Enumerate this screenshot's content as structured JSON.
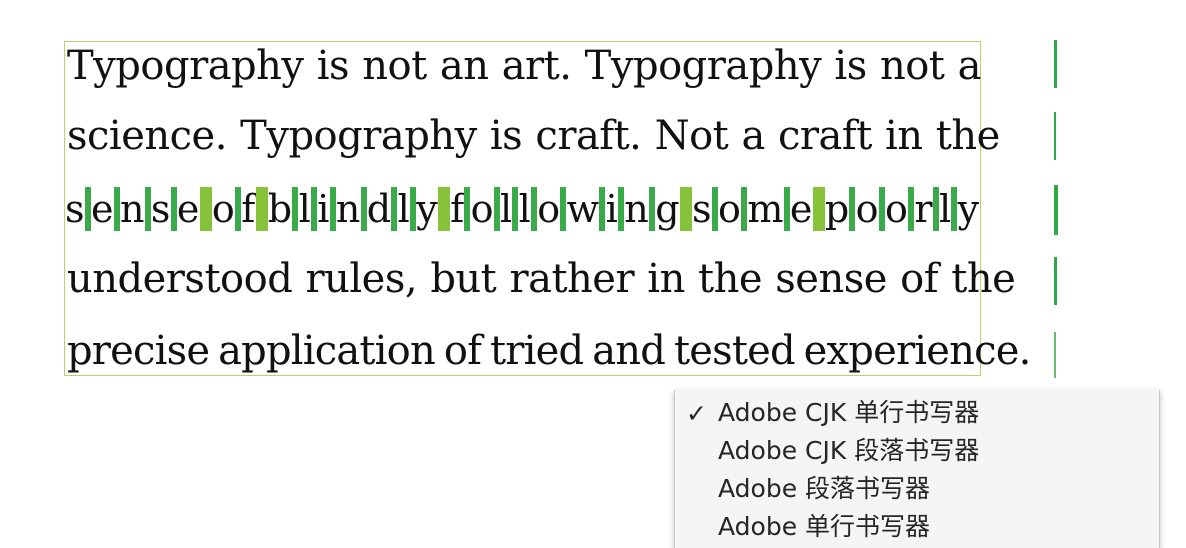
{
  "text_frame": {
    "lines": [
      "Typography is not an art. Typography is not a",
      "science. Typography is craft. Not a craft in the",
      "sense of blindly following some poorly",
      "understood rules, but rather in the sense of the",
      "precise application of tried and tested experience."
    ],
    "highlighted_line_index": 2
  },
  "colors": {
    "frame_border": "#b7d46a",
    "letter_gap": "#3aaa4a",
    "word_gap": "#86c23a",
    "indicator": "#2fa84a"
  },
  "composer_menu": {
    "selected_index": 0,
    "checkmark": "✓",
    "items": [
      "Adobe CJK 单行书写器",
      "Adobe CJK 段落书写器",
      "Adobe 段落书写器",
      "Adobe 单行书写器"
    ]
  }
}
